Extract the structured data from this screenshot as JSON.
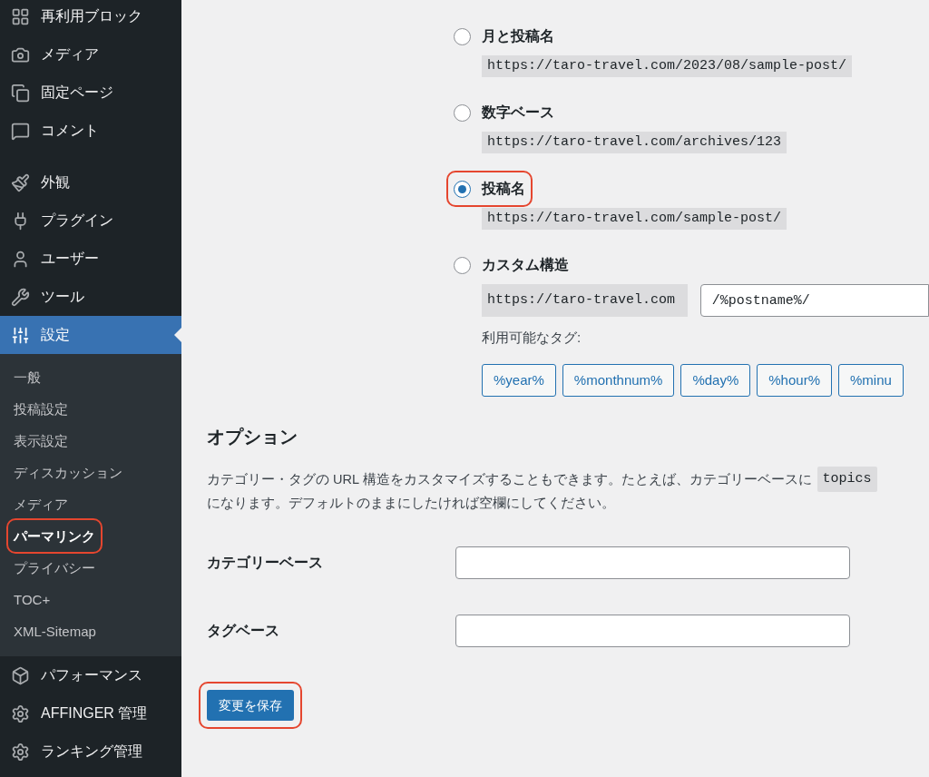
{
  "sidebar": {
    "items": [
      {
        "label": "再利用ブロック",
        "selected": false
      },
      {
        "label": "メディア",
        "selected": false
      },
      {
        "label": "固定ページ",
        "selected": false
      },
      {
        "label": "コメント",
        "selected": false
      },
      {
        "label": "外観",
        "selected": false
      },
      {
        "label": "プラグイン",
        "selected": false
      },
      {
        "label": "ユーザー",
        "selected": false
      },
      {
        "label": "ツール",
        "selected": false
      },
      {
        "label": "設定",
        "selected": true,
        "children": [
          {
            "label": "一般",
            "selected": false,
            "highlighted": false
          },
          {
            "label": "投稿設定",
            "selected": false,
            "highlighted": false
          },
          {
            "label": "表示設定",
            "selected": false,
            "highlighted": false
          },
          {
            "label": "ディスカッション",
            "selected": false,
            "highlighted": false
          },
          {
            "label": "メディア",
            "selected": false,
            "highlighted": false
          },
          {
            "label": "パーマリンク",
            "selected": true,
            "highlighted": true
          },
          {
            "label": "プライバシー",
            "selected": false,
            "highlighted": false
          },
          {
            "label": "TOC+",
            "selected": false,
            "highlighted": false
          },
          {
            "label": "XML-Sitemap",
            "selected": false,
            "highlighted": false
          }
        ]
      },
      {
        "label": "パフォーマンス",
        "selected": false
      },
      {
        "label": "AFFINGER 管理",
        "selected": false
      },
      {
        "label": "ランキング管理",
        "selected": false
      }
    ]
  },
  "permalink_options": [
    {
      "kind": "preset",
      "label": "月と投稿名",
      "url": "https://taro-travel.com/2023/08/sample-post/",
      "selected": false,
      "highlighted": false
    },
    {
      "kind": "preset",
      "label": "数字ベース",
      "url": "https://taro-travel.com/archives/123",
      "selected": false,
      "highlighted": false
    },
    {
      "kind": "preset",
      "label": "投稿名",
      "url": "https://taro-travel.com/sample-post/",
      "selected": true,
      "highlighted": true
    },
    {
      "kind": "custom",
      "label": "カスタム構造",
      "url": "https://taro-travel.com",
      "value": "/%postname%/",
      "selected": false,
      "highlighted": false,
      "tags_label": "利用可能なタグ:",
      "tags": [
        "%year%",
        "%monthnum%",
        "%day%",
        "%hour%",
        "%minu"
      ]
    }
  ],
  "options": {
    "heading": "オプション",
    "description": {
      "before": "カテゴリー・タグの URL 構造をカスタマイズすることもできます。たとえば、カテゴリーベースに",
      "code": "topics",
      "after": "になります。デフォルトのままにしたければ空欄にしてください。"
    },
    "fields": [
      {
        "label": "カテゴリーベース"
      },
      {
        "label": "タグベース"
      }
    ]
  },
  "save_button": {
    "label": "変更を保存",
    "highlighted": true
  }
}
